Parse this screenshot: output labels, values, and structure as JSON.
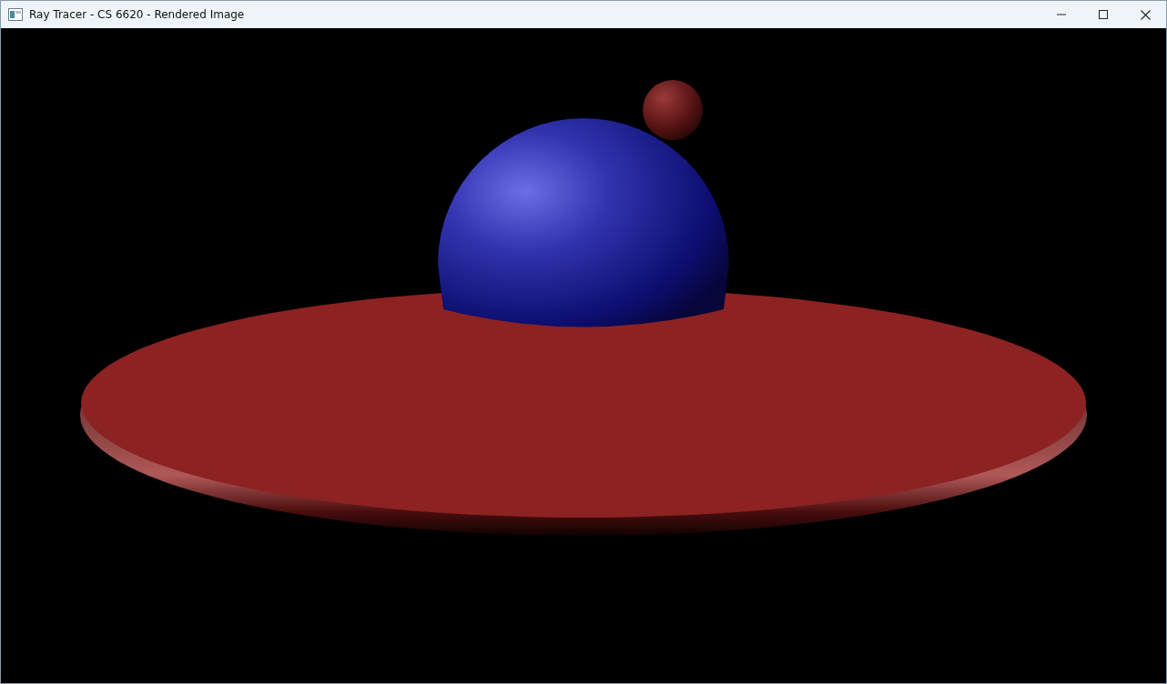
{
  "window": {
    "title": "Ray Tracer - CS 6620 - Rendered Image"
  }
}
